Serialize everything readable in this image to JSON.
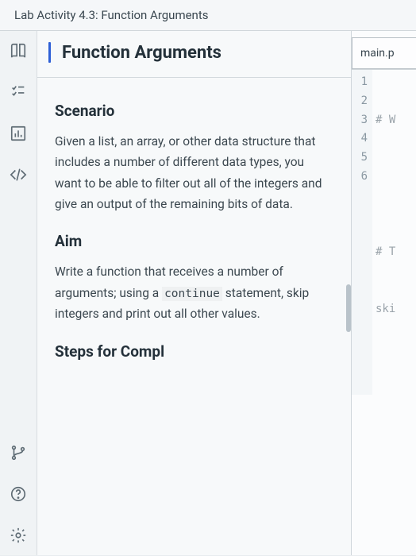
{
  "top_title": "Lab Activity 4.3: Function Arguments",
  "main": {
    "title": "Function Arguments",
    "sections": {
      "scenario_heading": "Scenario",
      "scenario_body": "Given a list, an array, or other data structure that includes a number of different data types, you want to be able to filter out all of the integers and give an output of the remaining bits of data.",
      "aim_heading": "Aim",
      "aim_body_pre": "Write a function that receives a number of arguments; using a ",
      "aim_code": "continue",
      "aim_body_post": " statement, skip integers and print out all other values.",
      "steps_heading": "Steps for Compl"
    }
  },
  "editor": {
    "tab_label": "main.p",
    "lines": [
      "1",
      "2",
      "3",
      "4",
      "5",
      "6"
    ],
    "code": [
      "# W",
      "",
      "",
      "# T",
      "ski",
      ""
    ]
  }
}
